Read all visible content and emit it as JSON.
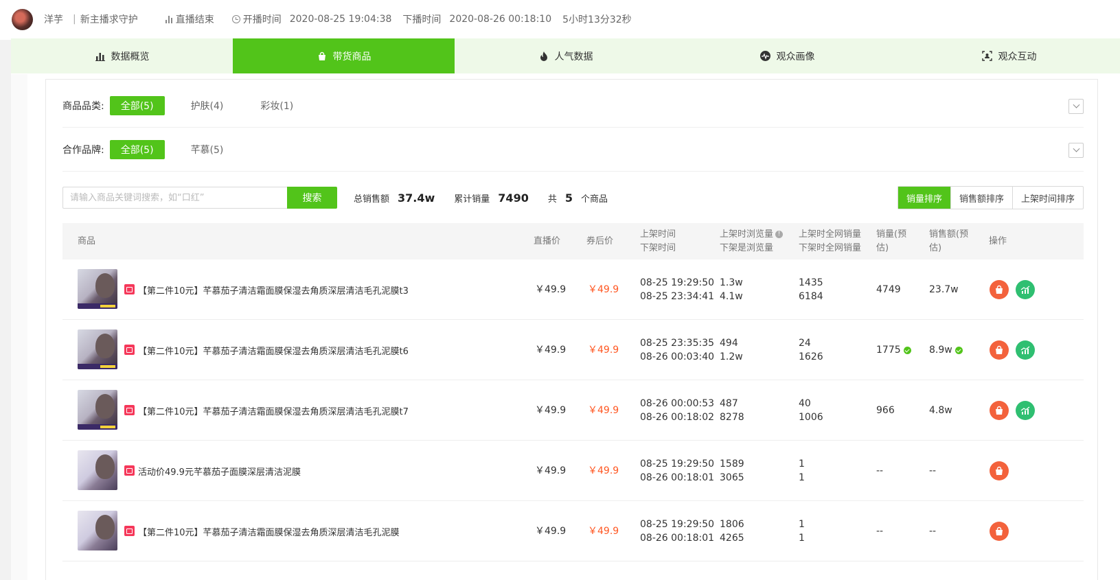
{
  "header": {
    "streamer_name": "洋芋",
    "separator": "|",
    "guard_text": "新主播求守护",
    "status": "直播结束",
    "start_label": "开播时间",
    "start_time": "2020-08-25 19:04:38",
    "end_label": "下播时间",
    "end_time": "2020-08-26 00:18:10",
    "duration": "5小时13分32秒"
  },
  "tabs": [
    {
      "label": "数据概览",
      "icon": "bar-chart-icon",
      "active": false
    },
    {
      "label": "带货商品",
      "icon": "shopping-bag-icon",
      "active": true
    },
    {
      "label": "人气数据",
      "icon": "flame-icon",
      "active": false
    },
    {
      "label": "观众画像",
      "icon": "pulse-icon",
      "active": false
    },
    {
      "label": "观众互动",
      "icon": "scan-user-icon",
      "active": false
    }
  ],
  "filters": {
    "category": {
      "label": "商品品类:",
      "options": [
        {
          "label": "全部(5)",
          "active": true
        },
        {
          "label": "护肤(4)",
          "active": false
        },
        {
          "label": "彩妆(1)",
          "active": false
        }
      ]
    },
    "brand": {
      "label": "合作品牌:",
      "options": [
        {
          "label": "全部(5)",
          "active": true
        },
        {
          "label": "芊慕(5)",
          "active": false
        }
      ]
    }
  },
  "search": {
    "placeholder": "请输入商品关键词搜索，如“口红”",
    "button": "搜索"
  },
  "stats": {
    "total_sales_label": "总销售额",
    "total_sales_value": "37.4w",
    "total_volume_label": "累计销量",
    "total_volume_value": "7490",
    "count_prefix": "共",
    "count_value": "5",
    "count_suffix": "个商品"
  },
  "sort": {
    "options": [
      "销量排序",
      "销售额排序",
      "上架时间排序"
    ],
    "active_index": 0
  },
  "table": {
    "headers": {
      "product": "商品",
      "live_price": "直播价",
      "coupon_price": "券后价",
      "time_line1": "上架时间",
      "time_line2": "下架时间",
      "views_line1": "上架时浏览量",
      "views_line2": "下架是浏览量",
      "net_line1": "上架时全网销量",
      "net_line2": "下架时全网销量",
      "volume_line1": "销量(预",
      "volume_line2": "估)",
      "revenue_line1": "销售额(预",
      "revenue_line2": "估)",
      "ops": "操作"
    },
    "rows": [
      {
        "name": "【第二件10元】芊慕茄子清洁霜面膜保湿去角质深层清洁毛孔泥膜t3",
        "live_price": "￥49.9",
        "coupon_price": "￥49.9",
        "on_time": "08-25 19:29:50",
        "off_time": "08-25 23:34:41",
        "views_on": "1.3w",
        "views_off": "4.1w",
        "net_on": "1435",
        "net_off": "6184",
        "volume": "4749",
        "revenue": "23.7w",
        "verified": false,
        "has_trend": true
      },
      {
        "name": "【第二件10元】芊慕茄子清洁霜面膜保湿去角质深层清洁毛孔泥膜t6",
        "live_price": "￥49.9",
        "coupon_price": "￥49.9",
        "on_time": "08-25 23:35:35",
        "off_time": "08-26 00:03:40",
        "views_on": "494",
        "views_off": "1.2w",
        "net_on": "24",
        "net_off": "1626",
        "volume": "1775",
        "revenue": "8.9w",
        "verified": true,
        "has_trend": true
      },
      {
        "name": "【第二件10元】芊慕茄子清洁霜面膜保湿去角质深层清洁毛孔泥膜t7",
        "live_price": "￥49.9",
        "coupon_price": "￥49.9",
        "on_time": "08-26 00:00:53",
        "off_time": "08-26 00:18:02",
        "views_on": "487",
        "views_off": "8278",
        "net_on": "40",
        "net_off": "1006",
        "volume": "966",
        "revenue": "4.8w",
        "verified": false,
        "has_trend": true
      },
      {
        "name": "活动价49.9元芊慕茄子面膜深层清洁泥膜",
        "live_price": "￥49.9",
        "coupon_price": "￥49.9",
        "on_time": "08-25 19:29:50",
        "off_time": "08-26 00:18:01",
        "views_on": "1589",
        "views_off": "3065",
        "net_on": "1",
        "net_off": "1",
        "volume": "--",
        "revenue": "--",
        "verified": false,
        "has_trend": false
      },
      {
        "name": "【第二件10元】芊慕茄子清洁霜面膜保湿去角质深层清洁毛孔泥膜",
        "live_price": "￥49.9",
        "coupon_price": "￥49.9",
        "on_time": "08-25 19:29:50",
        "off_time": "08-26 00:18:01",
        "views_on": "1806",
        "views_off": "4265",
        "net_on": "1",
        "net_off": "1",
        "volume": "--",
        "revenue": "--",
        "verified": false,
        "has_trend": false
      }
    ]
  },
  "colors": {
    "accent": "#52c41a",
    "price_red": "#ff5722",
    "bag_button": "#f3623c",
    "trend_button": "#2fbf71",
    "tab_bar_bg": "#eef9e8"
  }
}
